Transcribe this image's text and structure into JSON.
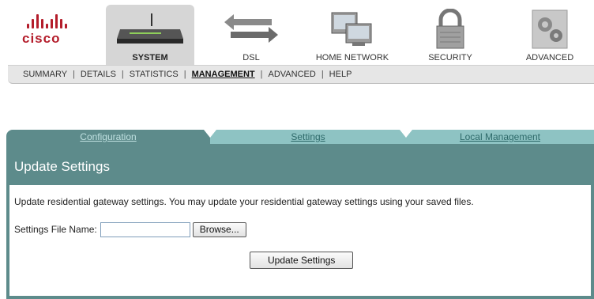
{
  "brand": {
    "name": "cisco",
    "color": "#b41d2b"
  },
  "nav": {
    "tabs": [
      {
        "label": "SYSTEM",
        "icon": "router-icon",
        "active": true
      },
      {
        "label": "DSL",
        "icon": "arrows-icon",
        "active": false
      },
      {
        "label": "HOME NETWORK",
        "icon": "computers-icon",
        "active": false
      },
      {
        "label": "SECURITY",
        "icon": "lock-icon",
        "active": false
      },
      {
        "label": "ADVANCED",
        "icon": "gears-icon",
        "active": false
      }
    ]
  },
  "subnav": {
    "items": [
      "SUMMARY",
      "DETAILS",
      "STATISTICS",
      "MANAGEMENT",
      "ADVANCED",
      "HELP"
    ],
    "active": "MANAGEMENT"
  },
  "content_tabs": [
    "Configuration",
    "Settings",
    "Local Management"
  ],
  "panel": {
    "title": "Update Settings",
    "description": "Update residential gateway settings. You may update your residential gateway settings using your saved files.",
    "file_label": "Settings File Name:",
    "file_value": "",
    "browse_label": "Browse...",
    "update_label": "Update Settings"
  },
  "colors": {
    "panel": "#5d8b8b",
    "tab_inactive": "#8ec3c3",
    "subnav": "#e6e6e6"
  }
}
